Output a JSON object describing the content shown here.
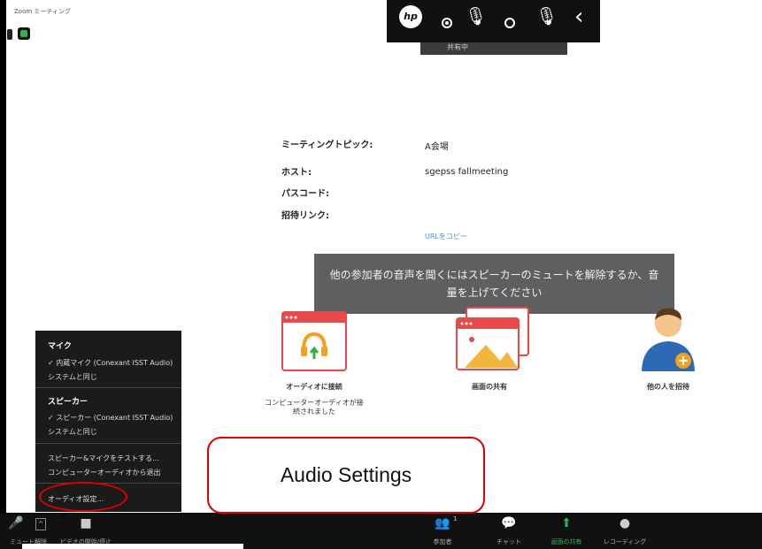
{
  "window": {
    "title": "Zoom ミーティング"
  },
  "hp_toolbar": {
    "logo": "hp"
  },
  "tab": {
    "label": "共有中"
  },
  "meeting_info": {
    "topic_label": "ミーティングトピック:",
    "topic_value": "A会場",
    "host_label": "ホスト:",
    "host_value": "sgepss fallmeeting",
    "passcode_label": "パスコード:",
    "invite_link_label": "招待リンク:",
    "url_copy": "URLをコピー"
  },
  "toast": {
    "text": "他の参加者の音声を聞くにはスピーカーのミュートを解除するか、音量を上げてください"
  },
  "tiles": {
    "audio": {
      "label": "オーディオに接続",
      "sub1": "コンピューターオーディオが接",
      "sub2": "続されました"
    },
    "share": {
      "label": "画面の共有"
    },
    "invite": {
      "label": "他の人を招待"
    }
  },
  "audio_menu": {
    "mic_header": "マイク",
    "mic_item": "✓ 内蔵マイク (Conexant ISST Audio)",
    "mic_system": "システムと同じ",
    "speaker_header": "スピーカー",
    "speaker_item": "✓ スピーカー (Conexant ISST Audio)",
    "speaker_system": "システムと同じ",
    "test": "スピーカー&マイクをテストする...",
    "leave": "コンピューターオーディオから退出",
    "settings": "オーディオ設定..."
  },
  "callout": {
    "text": "Audio Settings"
  },
  "toolbar": {
    "mute": "ミュート解除",
    "video": "ビデオの開始/停止",
    "participants": "参加者",
    "participants_count": "1",
    "chat": "チャット",
    "share": "画面の共有",
    "record": "レコーディング"
  },
  "colors": {
    "accent_green": "#2fb34a",
    "callout_red": "#e00000",
    "tile_red": "#e84a4a"
  }
}
